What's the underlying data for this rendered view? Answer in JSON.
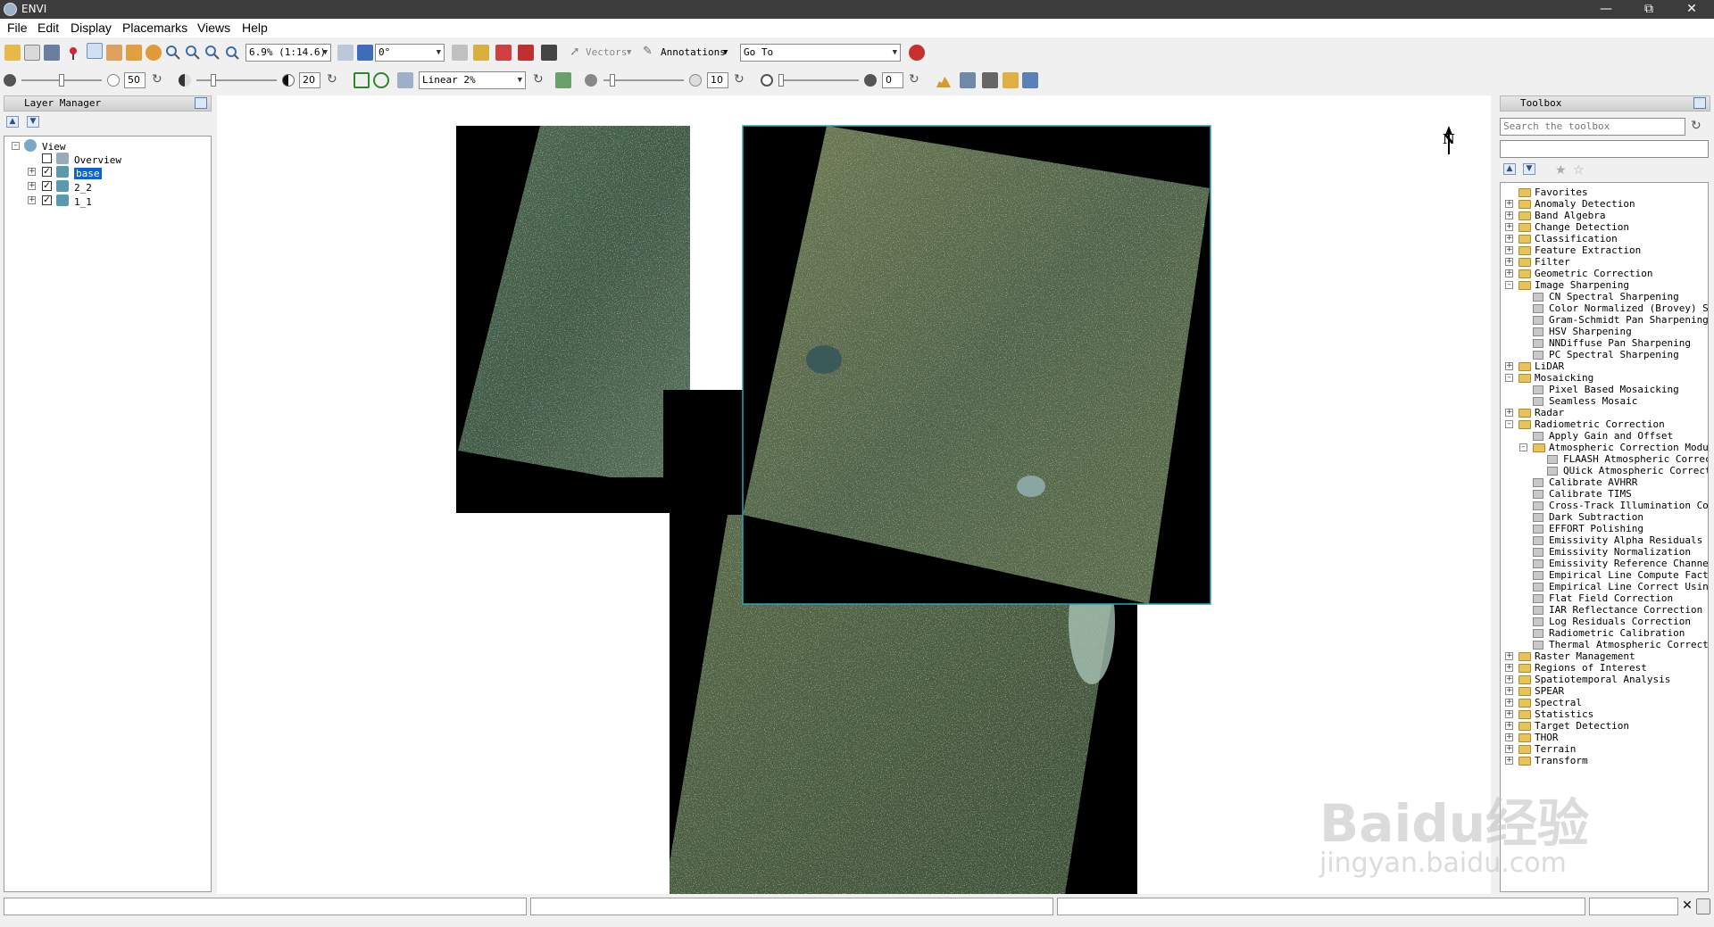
{
  "window": {
    "title": "ENVI"
  },
  "menu": [
    "File",
    "Edit",
    "Display",
    "Placemarks",
    "Views",
    "Help"
  ],
  "toolbar": {
    "zoom_value": "6.9% (1:14.6)",
    "rotation_value": "0°",
    "vectors_label": "Vectors",
    "annotations_label": "Annotations",
    "goto_value": "Go To",
    "brightness_value": "50",
    "contrast_value": "20",
    "stretch_value": "Linear 2%",
    "sharpen_value": "10",
    "transparency_value": "0"
  },
  "layer_manager": {
    "title": "Layer Manager",
    "root": "View",
    "overview": "Overview",
    "layers": [
      "base",
      "2_2",
      "1_1"
    ],
    "selected": "base"
  },
  "toolbox": {
    "title": "Toolbox",
    "search_placeholder": "Search the toolbox",
    "items": [
      {
        "label": "Favorites",
        "kind": "folder",
        "level": 0,
        "state": "none"
      },
      {
        "label": "Anomaly Detection",
        "kind": "folder",
        "level": 0,
        "state": "collapsed"
      },
      {
        "label": "Band Algebra",
        "kind": "folder",
        "level": 0,
        "state": "collapsed"
      },
      {
        "label": "Change Detection",
        "kind": "folder",
        "level": 0,
        "state": "collapsed"
      },
      {
        "label": "Classification",
        "kind": "folder",
        "level": 0,
        "state": "collapsed"
      },
      {
        "label": "Feature Extraction",
        "kind": "folder",
        "level": 0,
        "state": "collapsed"
      },
      {
        "label": "Filter",
        "kind": "folder",
        "level": 0,
        "state": "collapsed"
      },
      {
        "label": "Geometric Correction",
        "kind": "folder",
        "level": 0,
        "state": "collapsed"
      },
      {
        "label": "Image Sharpening",
        "kind": "folder",
        "level": 0,
        "state": "expanded"
      },
      {
        "label": "CN Spectral Sharpening",
        "kind": "tool",
        "level": 1,
        "state": "none"
      },
      {
        "label": "Color Normalized (Brovey) Sh",
        "kind": "tool",
        "level": 1,
        "state": "none"
      },
      {
        "label": "Gram-Schmidt Pan Sharpening",
        "kind": "tool",
        "level": 1,
        "state": "none"
      },
      {
        "label": "HSV Sharpening",
        "kind": "tool",
        "level": 1,
        "state": "none"
      },
      {
        "label": "NNDiffuse Pan Sharpening",
        "kind": "tool",
        "level": 1,
        "state": "none"
      },
      {
        "label": "PC Spectral Sharpening",
        "kind": "tool",
        "level": 1,
        "state": "none"
      },
      {
        "label": "LiDAR",
        "kind": "folder",
        "level": 0,
        "state": "collapsed"
      },
      {
        "label": "Mosaicking",
        "kind": "folder",
        "level": 0,
        "state": "expanded"
      },
      {
        "label": "Pixel Based Mosaicking",
        "kind": "tool",
        "level": 1,
        "state": "none"
      },
      {
        "label": "Seamless Mosaic",
        "kind": "tool",
        "level": 1,
        "state": "none"
      },
      {
        "label": "Radar",
        "kind": "folder",
        "level": 0,
        "state": "collapsed"
      },
      {
        "label": "Radiometric Correction",
        "kind": "folder",
        "level": 0,
        "state": "expanded"
      },
      {
        "label": "Apply Gain and Offset",
        "kind": "tool",
        "level": 1,
        "state": "none"
      },
      {
        "label": "Atmospheric Correction Modul",
        "kind": "folder",
        "level": 1,
        "state": "expanded"
      },
      {
        "label": "FLAASH Atmospheric Correc",
        "kind": "tool",
        "level": 2,
        "state": "none"
      },
      {
        "label": "QUick Atmospheric Correct",
        "kind": "tool",
        "level": 2,
        "state": "none"
      },
      {
        "label": "Calibrate AVHRR",
        "kind": "tool",
        "level": 1,
        "state": "none"
      },
      {
        "label": "Calibrate TIMS",
        "kind": "tool",
        "level": 1,
        "state": "none"
      },
      {
        "label": "Cross-Track Illumination Cor",
        "kind": "tool",
        "level": 1,
        "state": "none"
      },
      {
        "label": "Dark Subtraction",
        "kind": "tool",
        "level": 1,
        "state": "none"
      },
      {
        "label": "EFFORT Polishing",
        "kind": "tool",
        "level": 1,
        "state": "none"
      },
      {
        "label": "Emissivity Alpha Residuals",
        "kind": "tool",
        "level": 1,
        "state": "none"
      },
      {
        "label": "Emissivity Normalization",
        "kind": "tool",
        "level": 1,
        "state": "none"
      },
      {
        "label": "Emissivity Reference Channel",
        "kind": "tool",
        "level": 1,
        "state": "none"
      },
      {
        "label": "Empirical Line Compute Facto",
        "kind": "tool",
        "level": 1,
        "state": "none"
      },
      {
        "label": "Empirical Line Correct Using",
        "kind": "tool",
        "level": 1,
        "state": "none"
      },
      {
        "label": "Flat Field Correction",
        "kind": "tool",
        "level": 1,
        "state": "none"
      },
      {
        "label": "IAR Reflectance Correction",
        "kind": "tool",
        "level": 1,
        "state": "none"
      },
      {
        "label": "Log Residuals Correction",
        "kind": "tool",
        "level": 1,
        "state": "none"
      },
      {
        "label": "Radiometric Calibration",
        "kind": "tool",
        "level": 1,
        "state": "none"
      },
      {
        "label": "Thermal Atmospheric Correcti",
        "kind": "tool",
        "level": 1,
        "state": "none"
      },
      {
        "label": "Raster Management",
        "kind": "folder",
        "level": 0,
        "state": "collapsed"
      },
      {
        "label": "Regions of Interest",
        "kind": "folder",
        "level": 0,
        "state": "collapsed"
      },
      {
        "label": "Spatiotemporal Analysis",
        "kind": "folder",
        "level": 0,
        "state": "collapsed"
      },
      {
        "label": "SPEAR",
        "kind": "folder",
        "level": 0,
        "state": "collapsed"
      },
      {
        "label": "Spectral",
        "kind": "folder",
        "level": 0,
        "state": "collapsed"
      },
      {
        "label": "Statistics",
        "kind": "folder",
        "level": 0,
        "state": "collapsed"
      },
      {
        "label": "Target Detection",
        "kind": "folder",
        "level": 0,
        "state": "collapsed"
      },
      {
        "label": "THOR",
        "kind": "folder",
        "level": 0,
        "state": "collapsed"
      },
      {
        "label": "Terrain",
        "kind": "folder",
        "level": 0,
        "state": "collapsed"
      },
      {
        "label": "Transform",
        "kind": "folder",
        "level": 0,
        "state": "collapsed"
      }
    ]
  },
  "viewport": {
    "north_arrow": "N"
  },
  "watermark": {
    "line1": "Baidu经验",
    "line2": "jingyan.baidu.com"
  },
  "colors": {
    "selection": "#0a64d8",
    "active_outline": "#2aa6b8",
    "folder": "#e7c35a"
  }
}
